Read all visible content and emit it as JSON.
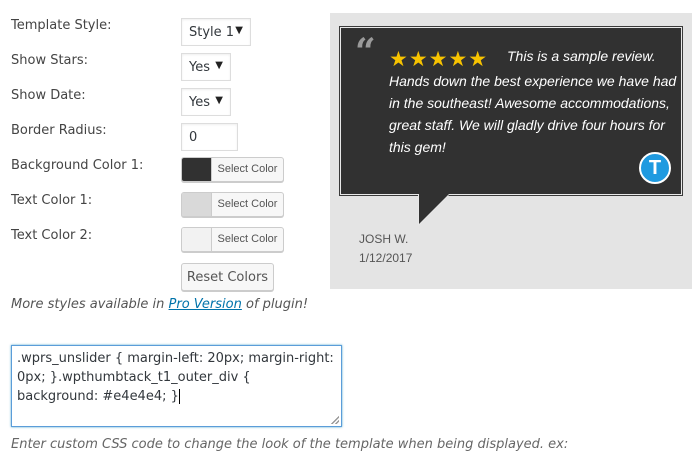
{
  "settings": {
    "template_style": {
      "label": "Template Style:",
      "value": "Style 1"
    },
    "show_stars": {
      "label": "Show Stars:",
      "value": "Yes"
    },
    "show_date": {
      "label": "Show Date:",
      "value": "Yes"
    },
    "border_radius": {
      "label": "Border Radius:",
      "value": "0"
    },
    "bg_color_1": {
      "label": "Background Color 1:",
      "button": "Select Color",
      "color": "#313131"
    },
    "text_color_1": {
      "label": "Text Color 1:",
      "button": "Select Color",
      "color": "#d9d9d9"
    },
    "text_color_2": {
      "label": "Text Color 2:",
      "button": "Select Color",
      "color": "#f2f2f2"
    },
    "reset_label": "Reset Colors"
  },
  "pro_note": {
    "prefix": "More styles available in",
    "link": "Pro Version",
    "suffix": "of plugin!"
  },
  "preview": {
    "stars": "★★★★★",
    "rating": 5,
    "review_line1": "This is a sample review.",
    "review_rest": "Hands down the best experience we have had in the southeast! Awesome accommodations, great staff. We will gladly drive four hours for this gem!",
    "author": "JOSH W.",
    "date": "1/12/2017",
    "badge": "T",
    "bg_color": "#e4e4e4",
    "bubble_color": "#313131",
    "star_color": "#f7c300"
  },
  "custom_css": {
    "value": ".wprs_unslider { margin-left: 20px; margin-right: 0px; }.wpthumbtack_t1_outer_div { background: #e4e4e4; }",
    "help": "Enter custom CSS code to change the look of the template when being displayed. ex:"
  }
}
